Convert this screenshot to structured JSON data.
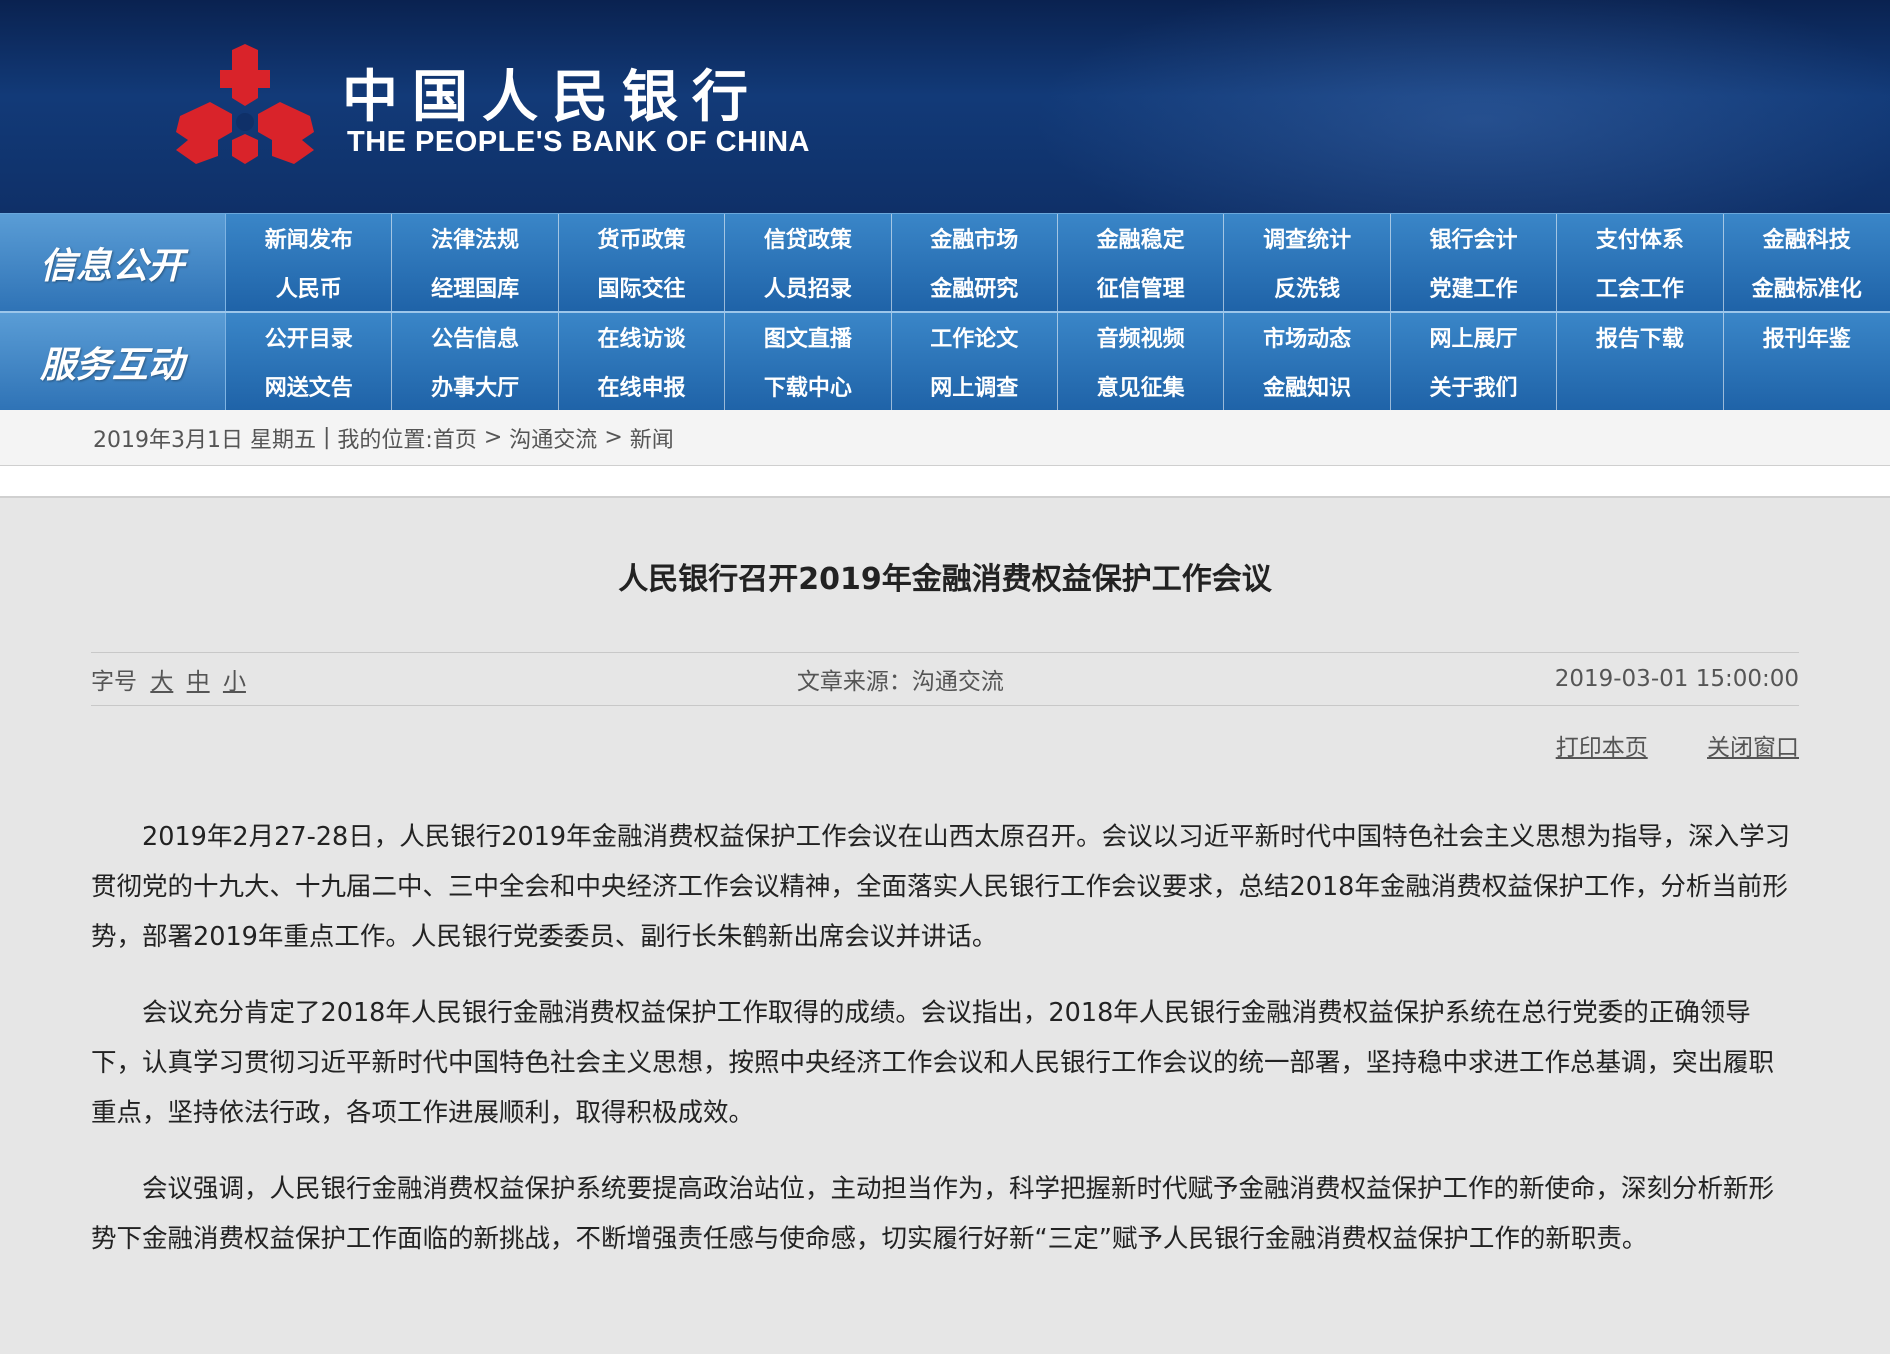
{
  "header": {
    "logo_cn": "中国人民银行",
    "logo_en": "THE PEOPLE'S BANK OF CHINA"
  },
  "colors": {
    "logo_red": "#d9232a",
    "nav_blue": "#2b74bb",
    "header_navy": "#0f3068"
  },
  "nav": {
    "band1": {
      "label": "信息公开",
      "row1": [
        "新闻发布",
        "法律法规",
        "货币政策",
        "信贷政策",
        "金融市场",
        "金融稳定",
        "调查统计",
        "银行会计",
        "支付体系",
        "金融科技"
      ],
      "row2": [
        "人民币",
        "经理国库",
        "国际交往",
        "人员招录",
        "金融研究",
        "征信管理",
        "反洗钱",
        "党建工作",
        "工会工作",
        "金融标准化"
      ]
    },
    "band2": {
      "label": "服务互动",
      "row1": [
        "公开目录",
        "公告信息",
        "在线访谈",
        "图文直播",
        "工作论文",
        "音频视频",
        "市场动态",
        "网上展厅",
        "报告下载",
        "报刊年鉴"
      ],
      "row2": [
        "网送文告",
        "办事大厅",
        "在线申报",
        "下载中心",
        "网上调查",
        "意见征集",
        "金融知识",
        "关于我们"
      ]
    }
  },
  "breadcrumb": {
    "date": "2019年3月1日",
    "weekday": "星期五",
    "separator": "|",
    "location_label": "我的位置:",
    "home": "首页",
    "arrow": ">",
    "section": "沟通交流",
    "current": "新闻"
  },
  "article": {
    "title": "人民银行召开2019年金融消费权益保护工作会议",
    "font_size_label": "字号",
    "font_size_large": "大",
    "font_size_medium": "中",
    "font_size_small": "小",
    "source": "文章来源：沟通交流",
    "datetime": "2019-03-01 15:00:00",
    "print_label": "打印本页",
    "close_label": "关闭窗口",
    "paragraphs": [
      "2019年2月27-28日，人民银行2019年金融消费权益保护工作会议在山西太原召开。会议以习近平新时代中国特色社会主义思想为指导，深入学习贯彻党的十九大、十九届二中、三中全会和中央经济工作会议精神，全面落实人民银行工作会议要求，总结2018年金融消费权益保护工作，分析当前形势，部署2019年重点工作。人民银行党委委员、副行长朱鹤新出席会议并讲话。",
      "会议充分肯定了2018年人民银行金融消费权益保护工作取得的成绩。会议指出，2018年人民银行金融消费权益保护系统在总行党委的正确领导下，认真学习贯彻习近平新时代中国特色社会主义思想，按照中央经济工作会议和人民银行工作会议的统一部署，坚持稳中求进工作总基调，突出履职重点，坚持依法行政，各项工作进展顺利，取得积极成效。",
      "会议强调，人民银行金融消费权益保护系统要提高政治站位，主动担当作为，科学把握新时代赋予金融消费权益保护工作的新使命，深刻分析新形势下金融消费权益保护工作面临的新挑战，不断增强责任感与使命感，切实履行好新“三定”赋予人民银行金融消费权益保护工作的新职责。"
    ]
  }
}
